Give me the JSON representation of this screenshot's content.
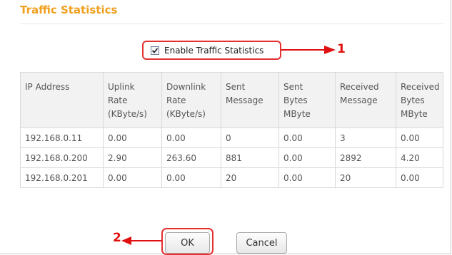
{
  "dialog": {
    "title": "Traffic Statistics"
  },
  "enable": {
    "label": "Enable Traffic Statistics",
    "checked": true
  },
  "annotations": {
    "callout_1": "1",
    "callout_2": "2",
    "color": "#e01010"
  },
  "table": {
    "headers": [
      [
        "IP Address"
      ],
      [
        "Uplink",
        "Rate",
        "(KByte/s)"
      ],
      [
        "Downlink",
        "Rate",
        "(KByte/s)"
      ],
      [
        "Sent",
        "Message"
      ],
      [
        "Sent",
        "Bytes",
        "MByte"
      ],
      [
        "Received",
        "Message"
      ],
      [
        "Received",
        "Bytes",
        "MByte"
      ]
    ],
    "rows": [
      [
        "192.168.0.11",
        "0.00",
        "0.00",
        "0",
        "0.00",
        "3",
        "0.00"
      ],
      [
        "192.168.0.200",
        "2.90",
        "263.60",
        "881",
        "0.00",
        "2892",
        "4.20"
      ],
      [
        "192.168.0.201",
        "0.00",
        "0.00",
        "20",
        "0.00",
        "20",
        "0.00"
      ]
    ]
  },
  "buttons": {
    "ok": "OK",
    "cancel": "Cancel"
  },
  "colors": {
    "title": "#f0a020",
    "highlight": "#e53030"
  }
}
